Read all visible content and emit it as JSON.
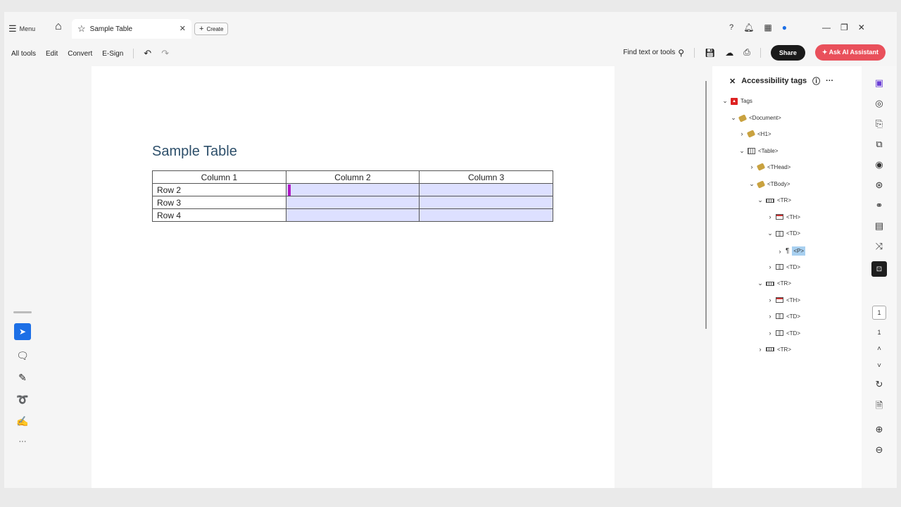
{
  "titlebar": {
    "menu_label": "Menu",
    "tab_title": "Sample Table",
    "create_label": "Create"
  },
  "toolbar": {
    "items": [
      "All tools",
      "Edit",
      "Convert",
      "E-Sign"
    ],
    "find_label": "Find text or tools",
    "share_label": "Share",
    "ai_label": "Ask AI Assistant"
  },
  "document": {
    "title": "Sample Table",
    "headers": [
      "Column 1",
      "Column 2",
      "Column 3"
    ],
    "rows": [
      [
        "Row 2",
        "",
        ""
      ],
      [
        "Row 3",
        "",
        ""
      ],
      [
        "Row 4",
        "",
        ""
      ]
    ]
  },
  "panel": {
    "title": "Accessibility tags",
    "tree": [
      {
        "label": "Tags"
      },
      {
        "label": "<Document>"
      },
      {
        "label": "<H1>"
      },
      {
        "label": "<Table>"
      },
      {
        "label": "<THead>"
      },
      {
        "label": "<TBody>"
      },
      {
        "label": "<TR>"
      },
      {
        "label": "<TH>"
      },
      {
        "label": "<TD>"
      },
      {
        "label": "<P>"
      },
      {
        "label": "<TD>"
      },
      {
        "label": "<TR>"
      },
      {
        "label": "<TH>"
      },
      {
        "label": "<TD>"
      },
      {
        "label": "<TD>"
      },
      {
        "label": "<TR>"
      }
    ]
  },
  "rail": {
    "page_current": "1",
    "page_total": "1"
  }
}
